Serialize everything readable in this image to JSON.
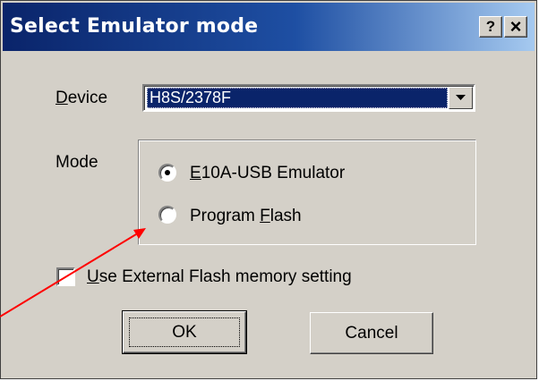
{
  "window": {
    "title": "Select Emulator mode",
    "help_button": "?",
    "close_button": "×"
  },
  "device": {
    "label_underlined": "D",
    "label_rest": "evice",
    "value": "H8S/2378F"
  },
  "mode": {
    "label": "Mode",
    "options": [
      {
        "underlined": "E",
        "rest": "10A-USB Emulator",
        "before": "",
        "selected": true
      },
      {
        "before": "Program ",
        "underlined": "F",
        "rest": "lash",
        "selected": false
      }
    ]
  },
  "external_flash": {
    "underlined": "U",
    "rest": "se External Flash memory setting",
    "checked": false
  },
  "buttons": {
    "ok": "OK",
    "cancel": "Cancel"
  },
  "annotation": {
    "arrow_color": "#ff0000"
  }
}
